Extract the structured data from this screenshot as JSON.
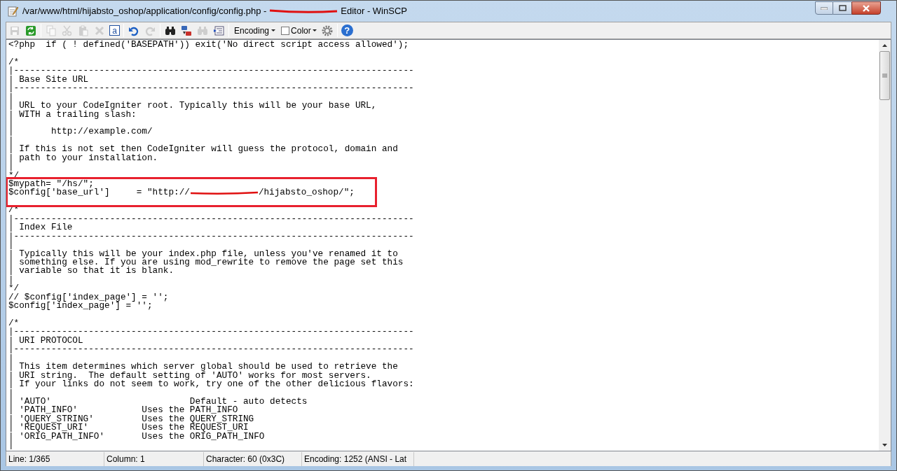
{
  "window": {
    "title_before": "/var/www/html/hijabsto_oshop/application/config/config.php -",
    "title_after": "Editor - WinSCP"
  },
  "toolbar": [
    {
      "kind": "icon",
      "disabled": true
    },
    {
      "kind": "icon",
      "disabled": false
    },
    {
      "kind": "separator"
    },
    {
      "kind": "icon",
      "disabled": true
    },
    {
      "kind": "icon",
      "disabled": true
    },
    {
      "kind": "icon",
      "disabled": true
    },
    {
      "kind": "icon",
      "disabled": true
    },
    {
      "kind": "glyph",
      "text": "a",
      "disabled": false
    },
    {
      "kind": "separator"
    },
    {
      "kind": "icon",
      "disabled": false
    },
    {
      "kind": "icon",
      "disabled": true
    },
    {
      "kind": "separator"
    },
    {
      "kind": "icon",
      "disabled": false
    },
    {
      "kind": "icon",
      "disabled": false
    },
    {
      "kind": "icon",
      "disabled": true
    },
    {
      "kind": "icon",
      "disabled": false
    },
    {
      "kind": "separator"
    },
    {
      "kind": "dropdown",
      "label": "Encoding"
    },
    {
      "kind": "check_dropdown",
      "label": "Color",
      "checked": false
    },
    {
      "kind": "icon",
      "disabled": false
    },
    {
      "kind": "separator"
    },
    {
      "kind": "glyph",
      "text": "?",
      "disabled": false
    }
  ],
  "code": [
    {
      "kind": "text",
      "text": "<?php  if ( ! defined('BASEPATH')) exit('No direct script access allowed');"
    },
    {
      "kind": "blank"
    },
    {
      "kind": "text",
      "text": "/*"
    },
    {
      "kind": "text",
      "text": "|---------------------------------------------------------------------------"
    },
    {
      "kind": "text",
      "text": "| Base Site URL"
    },
    {
      "kind": "text",
      "text": "|---------------------------------------------------------------------------"
    },
    {
      "kind": "text",
      "text": "|"
    },
    {
      "kind": "text",
      "text": "| URL to your CodeIgniter root. Typically this will be your base URL,"
    },
    {
      "kind": "text",
      "text": "| WITH a trailing slash:"
    },
    {
      "kind": "text",
      "text": "|"
    },
    {
      "kind": "text",
      "text": "|       http://example.com/"
    },
    {
      "kind": "text",
      "text": "|"
    },
    {
      "kind": "text",
      "text": "| If this is not set then CodeIgniter will guess the protocol, domain and"
    },
    {
      "kind": "text",
      "text": "| path to your installation."
    },
    {
      "kind": "text",
      "text": "|"
    },
    {
      "kind": "text",
      "text": "*/"
    },
    {
      "kind": "boxed",
      "lines": [
        {
          "kind": "text",
          "text": "$mypath= \"/hs/\";"
        },
        {
          "kind": "redacted",
          "before": "$config['base_url']     = \"http://",
          "after": "/hijabsto_oshop/\";"
        }
      ]
    },
    {
      "kind": "blank"
    },
    {
      "kind": "text",
      "text": "/*"
    },
    {
      "kind": "text",
      "text": "|---------------------------------------------------------------------------"
    },
    {
      "kind": "text",
      "text": "| Index File"
    },
    {
      "kind": "text",
      "text": "|---------------------------------------------------------------------------"
    },
    {
      "kind": "text",
      "text": "|"
    },
    {
      "kind": "text",
      "text": "| Typically this will be your index.php file, unless you've renamed it to"
    },
    {
      "kind": "text",
      "text": "| something else. If you are using mod_rewrite to remove the page set this"
    },
    {
      "kind": "text",
      "text": "| variable so that it is blank."
    },
    {
      "kind": "text",
      "text": "|"
    },
    {
      "kind": "text",
      "text": "*/"
    },
    {
      "kind": "text",
      "text": "// $config['index_page'] = '';"
    },
    {
      "kind": "text",
      "text": "$config['index_page'] = '';"
    },
    {
      "kind": "blank"
    },
    {
      "kind": "text",
      "text": "/*"
    },
    {
      "kind": "text",
      "text": "|---------------------------------------------------------------------------"
    },
    {
      "kind": "text",
      "text": "| URI PROTOCOL"
    },
    {
      "kind": "text",
      "text": "|---------------------------------------------------------------------------"
    },
    {
      "kind": "text",
      "text": "|"
    },
    {
      "kind": "text",
      "text": "| This item determines which server global should be used to retrieve the"
    },
    {
      "kind": "text",
      "text": "| URI string.  The default setting of 'AUTO' works for most servers."
    },
    {
      "kind": "text",
      "text": "| If your links do not seem to work, try one of the other delicious flavors:"
    },
    {
      "kind": "text",
      "text": "|"
    },
    {
      "kind": "text",
      "text": "| 'AUTO'                          Default - auto detects"
    },
    {
      "kind": "text",
      "text": "| 'PATH_INFO'            Uses the PATH_INFO"
    },
    {
      "kind": "text",
      "text": "| 'QUERY_STRING'         Uses the QUERY_STRING"
    },
    {
      "kind": "text",
      "text": "| 'REQUEST_URI'          Uses the REQUEST_URI"
    },
    {
      "kind": "text",
      "text": "| 'ORIG_PATH_INFO'       Uses the ORIG_PATH_INFO"
    },
    {
      "kind": "text",
      "text": "|"
    }
  ],
  "status_bar": [
    "Line: 1/365",
    "Column: 1",
    "Character: 60 (0x3C)",
    "Encoding: 1252  (ANSI - Lat"
  ]
}
